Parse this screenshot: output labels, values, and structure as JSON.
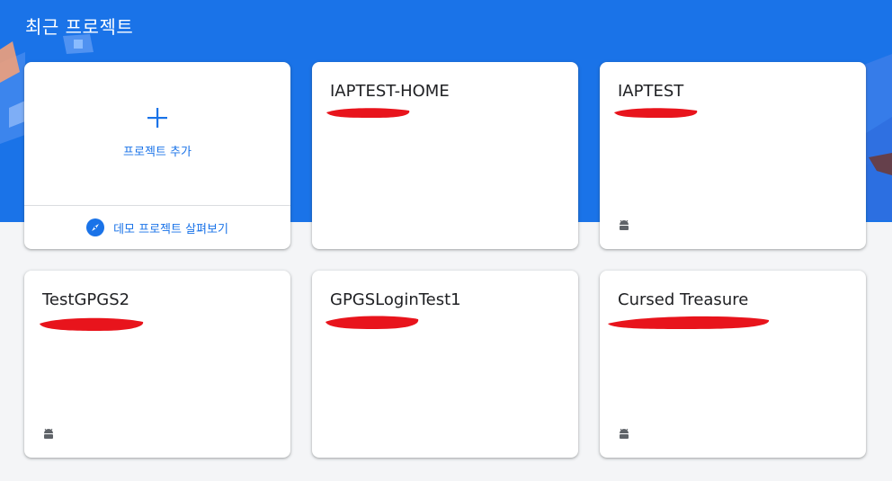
{
  "section": {
    "title": "최근 프로젝트"
  },
  "add_card": {
    "icon": "plus-icon",
    "label": "프로젝트 추가",
    "demo_icon": "compass-icon",
    "demo_label": "데모 프로젝트 살펴보기"
  },
  "projects": [
    {
      "name": "IAPTEST-HOME",
      "platform_icon": ""
    },
    {
      "name": "IAPTEST",
      "platform_icon": "android-icon"
    },
    {
      "name": "TestGPGS2",
      "platform_icon": "android-icon"
    },
    {
      "name": "GPGSLoginTest1",
      "platform_icon": ""
    },
    {
      "name": "Cursed Treasure",
      "platform_icon": "android-icon"
    }
  ],
  "colors": {
    "hero_background": "#1a73e8",
    "page_background": "#f4f5f7",
    "accent": "#1a73e8",
    "redaction": "#e8141c",
    "android_icon": "#5f6368"
  }
}
